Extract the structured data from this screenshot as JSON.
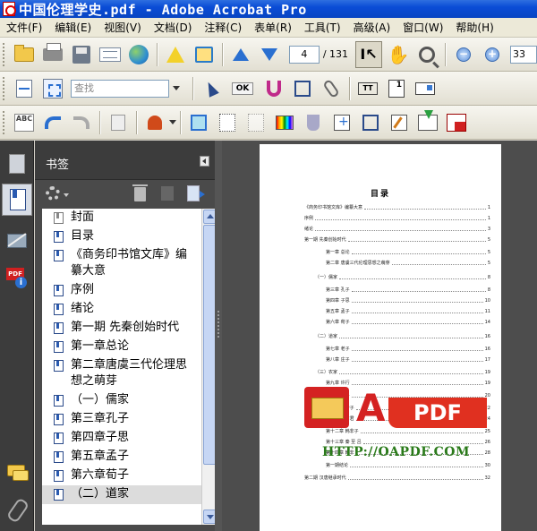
{
  "window": {
    "title": "中国伦理学史.pdf - Adobe Acrobat Pro"
  },
  "menu": [
    "文件(F)",
    "编辑(E)",
    "视图(V)",
    "文档(D)",
    "注释(C)",
    "表单(R)",
    "工具(T)",
    "高级(A)",
    "窗口(W)",
    "帮助(H)"
  ],
  "toolbar": {
    "page_current": "4",
    "page_total": "/ 131",
    "zoom_value": "33",
    "search_placeholder": "查找",
    "ok_label": "OK",
    "tt_label": "TT",
    "num_label": "1"
  },
  "panel": {
    "title": "书签"
  },
  "bookmarks": [
    {
      "label": "封面",
      "icon": "bookmark-grey-icon"
    },
    {
      "label": "目录",
      "icon": "bookmark-icon"
    },
    {
      "label": "《商务印书馆文库》编纂大意",
      "icon": "bookmark-icon"
    },
    {
      "label": "序例",
      "icon": "bookmark-icon"
    },
    {
      "label": "绪论",
      "icon": "bookmark-icon"
    },
    {
      "label": "第一期 先秦创始时代",
      "icon": "bookmark-icon"
    },
    {
      "label": "第一章总论",
      "icon": "bookmark-icon"
    },
    {
      "label": "第二章唐虞三代伦理思想之萌芽",
      "icon": "bookmark-icon"
    },
    {
      "label": "（一）儒家",
      "icon": "bookmark-icon"
    },
    {
      "label": "第三章孔子",
      "icon": "bookmark-icon"
    },
    {
      "label": "第四章子思",
      "icon": "bookmark-icon"
    },
    {
      "label": "第五章孟子",
      "icon": "bookmark-icon"
    },
    {
      "label": "第六章荀子",
      "icon": "bookmark-icon"
    },
    {
      "label": "（二）道家",
      "icon": "bookmark-icon"
    }
  ],
  "document": {
    "toc_title": "目录",
    "toc": [
      {
        "t": "《商务印书馆文库》编纂大意",
        "n": "1",
        "indent": 0
      },
      {
        "t": "序例",
        "n": "1",
        "indent": 0
      },
      {
        "t": "绪论",
        "n": "3",
        "indent": 0
      },
      {
        "t": "第一期 先秦创始时代",
        "n": "5",
        "indent": 0
      },
      {
        "t": "第一章 总论",
        "n": "5",
        "indent": 2
      },
      {
        "t": "第二章 唐虞三代伦理思想之萌芽",
        "n": "5",
        "indent": 2
      },
      {
        "t": "（一）儒家",
        "n": "8",
        "indent": 1
      },
      {
        "t": "第三章 孔子",
        "n": "8",
        "indent": 2
      },
      {
        "t": "第四章 子思",
        "n": "10",
        "indent": 2
      },
      {
        "t": "第五章 孟子",
        "n": "11",
        "indent": 2
      },
      {
        "t": "第六章 荀子",
        "n": "14",
        "indent": 2
      },
      {
        "t": "（二）道家",
        "n": "16",
        "indent": 1
      },
      {
        "t": "第七章 老子",
        "n": "16",
        "indent": 2
      },
      {
        "t": "第八章 庄子",
        "n": "17",
        "indent": 2
      },
      {
        "t": "（三）农家",
        "n": "19",
        "indent": 1
      },
      {
        "t": "第九章 许行",
        "n": "19",
        "indent": 2
      },
      {
        "t": "第十章 墨子",
        "n": "20",
        "indent": 2
      },
      {
        "t": "第十一章 管子",
        "n": "22",
        "indent": 2
      },
      {
        "t": "第十一章 商君",
        "n": "24",
        "indent": 2
      },
      {
        "t": "第十二章 韩非子",
        "n": "25",
        "indent": 2
      },
      {
        "t": "第十三章 秦 至 吕",
        "n": "26",
        "indent": 2
      },
      {
        "t": "第十四章 韩非",
        "n": "28",
        "indent": 2
      },
      {
        "t": "第一期结论",
        "n": "30",
        "indent": 2
      },
      {
        "t": "第二期 汉唐继承时代",
        "n": "32",
        "indent": 0
      }
    ]
  },
  "watermark": {
    "letter": "A",
    "pdf": "PDF",
    "url": "HTTP://OAPDF.COM"
  },
  "colors": {
    "titlebar": "#0a4cd6",
    "panel": "#4a4a4a",
    "docbg": "#4d4d4d",
    "watermark_red": "#d42222"
  }
}
